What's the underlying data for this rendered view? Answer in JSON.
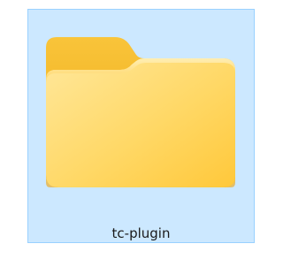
{
  "window": {
    "selected_item": {
      "name": "tc-plugin",
      "icon": "folder-icon",
      "selected": true
    }
  },
  "colors": {
    "selection_fill": "#cce8ff",
    "selection_border": "#99d1ff",
    "folder_back": "#f2b51e",
    "folder_front_light": "#ffe79a",
    "folder_front_dark": "#ffc83a"
  }
}
